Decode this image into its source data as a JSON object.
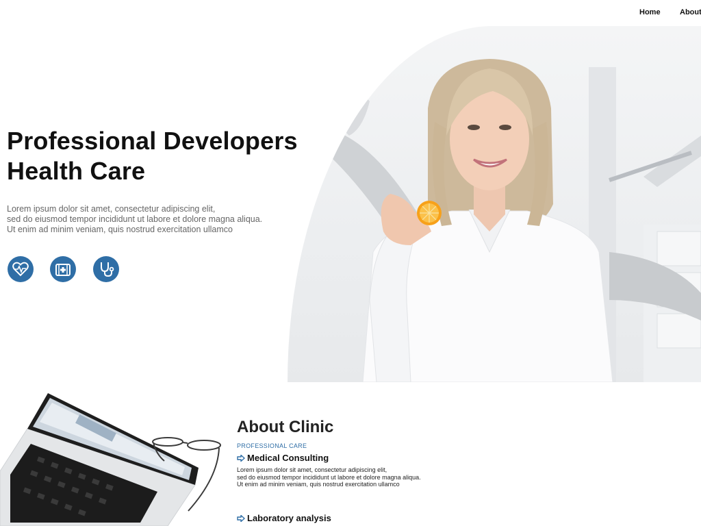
{
  "nav": {
    "home": "Home",
    "about": "About"
  },
  "hero": {
    "title_line1": "Professional Developers",
    "title_line2": "Health Care",
    "desc_line1": "Lorem ipsum dolor sit amet, consectetur adipiscing elit,",
    "desc_line2": "sed do eiusmod tempor incididunt ut labore et dolore magna aliqua.",
    "desc_line3": "Ut enim ad minim veniam, quis nostrud exercitation ullamco",
    "icons": [
      "heart-pulse-icon",
      "first-aid-kit-icon",
      "stethoscope-icon"
    ]
  },
  "about": {
    "title": "About Clinic",
    "subtitle": "PROFESSIONAL CARE",
    "services": [
      {
        "title": "Medical Consulting",
        "desc_line1": "Lorem ipsum dolor sit amet, consectetur adipiscing elit,",
        "desc_line2": "sed do eiusmod tempor incididunt ut labore et dolore magna aliqua.",
        "desc_line3": "Ut enim ad minim veniam, quis nostrud exercitation ullamco"
      },
      {
        "title": "Laboratory analysis"
      }
    ]
  },
  "colors": {
    "accent": "#2f6ea6",
    "text": "#111111",
    "muted": "#666666"
  }
}
